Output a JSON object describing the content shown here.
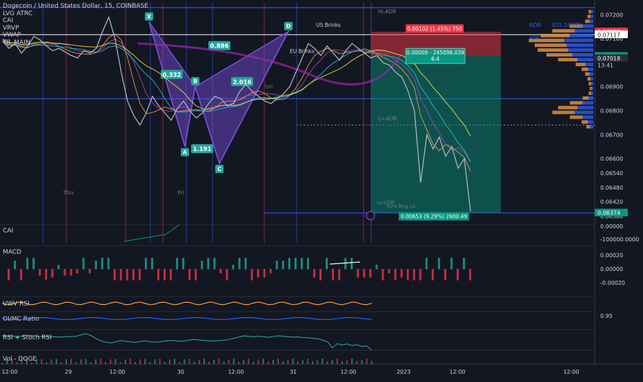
{
  "chart_data": {
    "type": "line",
    "title": "Dogecoin / United States Dollar, 15, COINBASE",
    "indicators": [
      "LVG ATRC",
      "CAI",
      "VRVP",
      "VWAP",
      "TR_MAIN"
    ],
    "price_axis": {
      "range": [
        0.0633,
        0.0725
      ],
      "ticks": [
        "0.07200",
        "0.07100",
        "0.06900",
        "0.06800",
        "0.06700",
        "0.06600",
        "0.06540",
        "0.06480",
        "0.06420",
        "0.06360"
      ]
    },
    "price_tags": [
      {
        "label": "0.07129",
        "value": 0.07129,
        "color": "#f23645"
      },
      {
        "label": "0.07117",
        "value": 0.07117,
        "color": "#ffffff"
      },
      {
        "label": "0.07027",
        "value": 0.07027,
        "color": "#089981"
      },
      {
        "label": "0.07018",
        "value": 0.07018,
        "color": "#2a2e39"
      },
      {
        "label": "0.06374",
        "value": 0.06374,
        "color": "#089981"
      }
    ],
    "countdown": "13:41",
    "time_axis": [
      "12:00",
      "29",
      "12:00",
      "30",
      "12:00",
      "31",
      "12:00",
      "2023",
      "12:00",
      "12:00"
    ],
    "day_labels": [
      "Thu",
      "Fri"
    ],
    "price_series": [
      0.0709,
      0.0706,
      0.0708,
      0.0704,
      0.0707,
      0.0711,
      0.07095,
      0.0707,
      0.0705,
      0.0706,
      0.07045,
      0.0703,
      0.0702,
      0.0705,
      0.0704,
      0.0706,
      0.0713,
      0.0719,
      0.071,
      0.0696,
      0.0684,
      0.0678,
      0.0674,
      0.0679,
      0.0686,
      0.0682,
      0.0679,
      0.0676,
      0.0681,
      0.0684,
      0.068,
      0.0677,
      0.0679,
      0.0683,
      0.0686,
      0.0685,
      0.0682,
      0.0683,
      0.0688,
      0.0691,
      0.0688,
      0.0686,
      0.0684,
      0.0683,
      0.0685,
      0.0687,
      0.069,
      0.0696,
      0.0702,
      0.0708,
      0.0706,
      0.0703,
      0.0707,
      0.0704,
      0.0701,
      0.0705,
      0.0708,
      0.0706,
      0.0704,
      0.0702,
      0.0703,
      0.07,
      0.0699,
      0.0696,
      0.0694,
      0.0688,
      0.068,
      0.065,
      0.067,
      0.0664,
      0.0669,
      0.0661,
      0.0665,
      0.0656,
      0.066,
      0.0638
    ],
    "harmonic": {
      "points": [
        {
          "label": "X",
          "value": 0.0717
        },
        {
          "label": "A",
          "value": 0.0665
        },
        {
          "label": "B",
          "value": 0.069
        },
        {
          "label": "C",
          "value": 0.0658
        },
        {
          "label": "D",
          "value": 0.0713
        }
      ],
      "ratios": [
        "0.886",
        "0.332",
        "2.016",
        "1.191"
      ]
    },
    "annotations": {
      "hi_adr": "Hi-ADR",
      "lo_adr": "Lo-ADR",
      "lo_adr2": "Lo-ADR",
      "rng_lo": "50% Rng-Lo",
      "eu_brinks": "EU Brinks",
      "us_brinks": "US Brinks",
      "adr": "ADR",
      "adr_value": "403.14PIPS",
      "adr_small": "ADR",
      "tyo": "tyo"
    },
    "position": {
      "stop_label": "0.00102 (1.45%) 750",
      "entry_label": "0.00009 - 245098.039",
      "entry_sub": "6.4",
      "target_label": "0.00653 (9.29%) 2600.49"
    },
    "panes": [
      {
        "name": "CAI",
        "ticks": [
          "0.00000",
          "-100000.0000"
        ]
      },
      {
        "name": "MACD",
        "ticks": [
          "0.00020",
          "0.00000",
          "-0.00020"
        ]
      },
      {
        "name": "VWV RSI",
        "ticks": []
      },
      {
        "name": "OI/MC Ratio",
        "ticks": [
          "0.95"
        ]
      },
      {
        "name": "RSI + Stoch RSI",
        "ticks": []
      },
      {
        "name": "Vol - DOGE",
        "ticks": []
      }
    ],
    "colors": {
      "up": "#089981",
      "down": "#f23645",
      "background": "#131722",
      "harmonic": "#7b4fe0"
    },
    "grid": false
  }
}
